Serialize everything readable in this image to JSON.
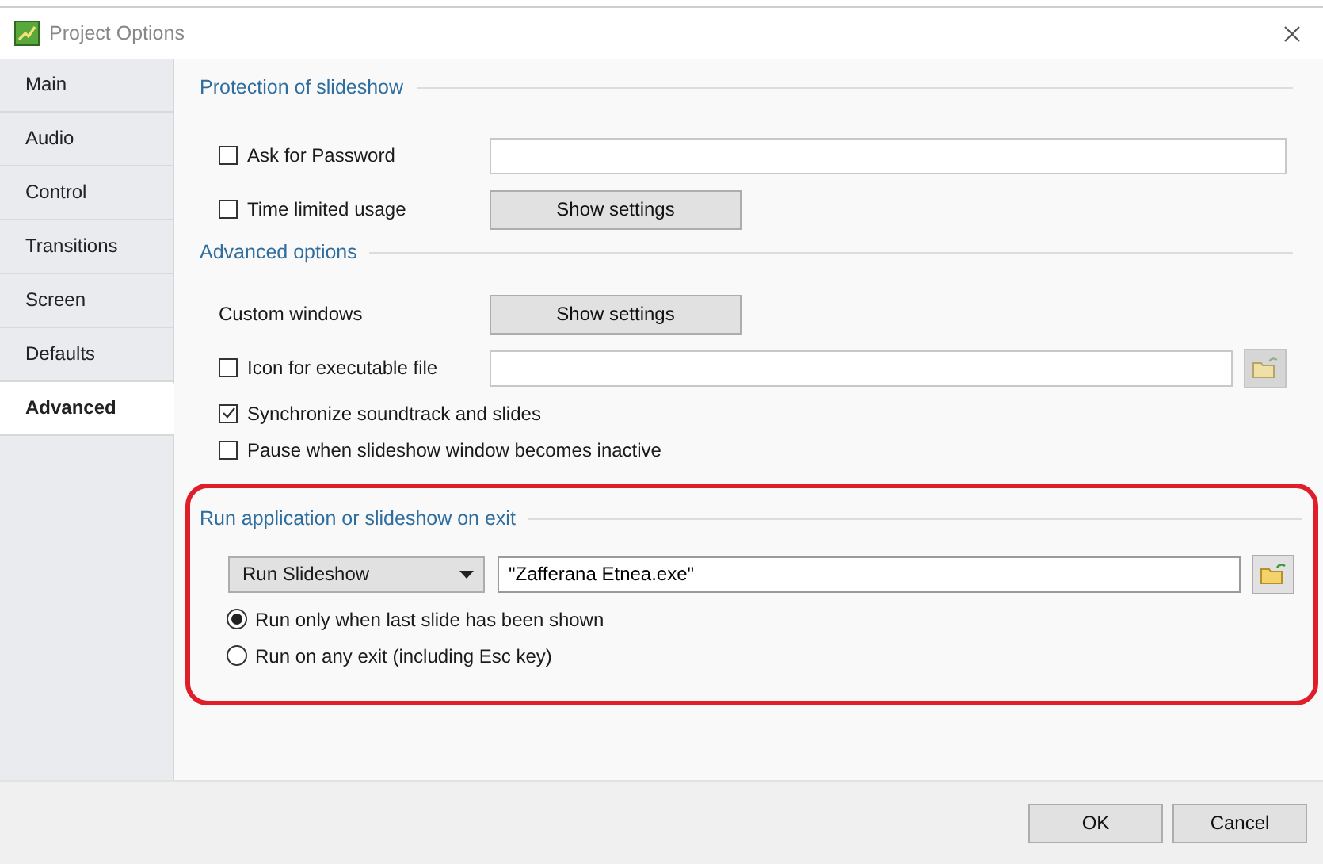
{
  "window": {
    "title": "Project Options"
  },
  "sidebar": {
    "items": [
      {
        "label": "Main",
        "selected": false
      },
      {
        "label": "Audio",
        "selected": false
      },
      {
        "label": "Control",
        "selected": false
      },
      {
        "label": "Transitions",
        "selected": false
      },
      {
        "label": "Screen",
        "selected": false
      },
      {
        "label": "Defaults",
        "selected": false
      },
      {
        "label": "Advanced",
        "selected": true
      }
    ]
  },
  "sections": [
    {
      "title": "Protection of slideshow",
      "highlighted": false,
      "rows": [
        {
          "kind": "checkbox-field",
          "label": "Ask for Password",
          "checked": false
        },
        {
          "kind": "checkbox-button",
          "label": "Time limited usage",
          "checked": false,
          "button": "Show settings"
        }
      ]
    },
    {
      "title": "Advanced options",
      "highlighted": false,
      "rows": [
        {
          "kind": "label-button",
          "label": "Custom windows",
          "button": "Show settings"
        },
        {
          "kind": "checkbox-file",
          "label": "Icon for executable file",
          "checked": false
        },
        {
          "kind": "checkbox",
          "label": "Synchronize soundtrack and slides",
          "checked": true
        },
        {
          "kind": "checkbox",
          "label": "Pause when slideshow window becomes inactive",
          "checked": false
        }
      ]
    },
    {
      "title": "Run application or slideshow on exit",
      "highlighted": true,
      "rows": [
        {
          "kind": "dropdown-file",
          "dropdown": "Run Slideshow",
          "value": "\"Zafferana Etnea.exe\""
        },
        {
          "kind": "radio",
          "label": "Run only when last slide has been shown",
          "selected": true
        },
        {
          "kind": "radio",
          "label": "Run on any exit (including Esc key)",
          "selected": false
        }
      ]
    }
  ],
  "buttons": [
    "OK",
    "Cancel"
  ]
}
